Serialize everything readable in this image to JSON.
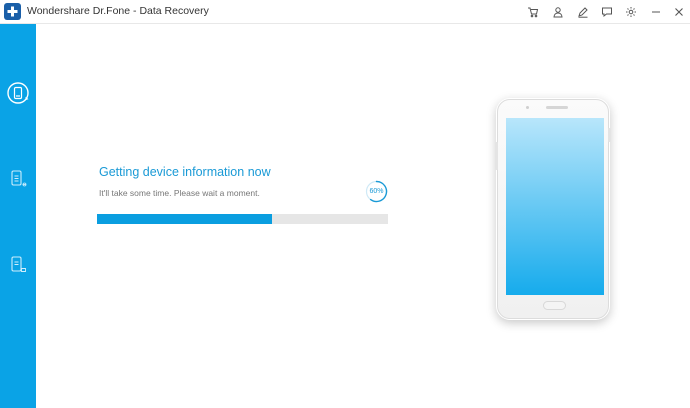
{
  "window": {
    "title": "Wondershare Dr.Fone - Data Recovery",
    "logo_icon": "drfone-plus-logo",
    "toolbar_icons": [
      "cart-icon",
      "account-icon",
      "edit-feedback-icon",
      "chat-icon",
      "settings-icon",
      "minimize-icon",
      "close-icon"
    ]
  },
  "sidebar": {
    "items": [
      {
        "icon": "device-recover-icon",
        "active": true
      },
      {
        "icon": "backup-recover-icon",
        "active": false
      },
      {
        "icon": "cloud-recover-icon",
        "active": false
      }
    ]
  },
  "status": {
    "title": "Getting device information now",
    "subtitle": "It'll take some time. Please wait a moment.",
    "percent_label": "60%",
    "progress": 0.6
  },
  "colors": {
    "accent": "#0aa3e6",
    "progress_fill": "#0a9ee0",
    "progress_track": "#e6e6e6",
    "title_text": "#1a9ad6"
  }
}
